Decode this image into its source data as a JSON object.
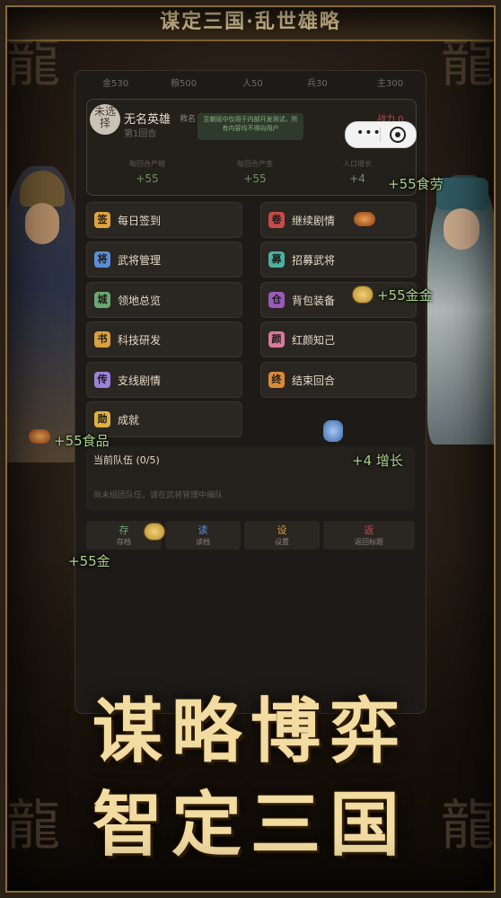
{
  "header": {
    "title": "谋定三国·乱世雄略"
  },
  "resources": [
    {
      "label": "金",
      "value": "530"
    },
    {
      "label": "粮",
      "value": "500"
    },
    {
      "label": "人",
      "value": "50"
    },
    {
      "label": "兵",
      "value": "30"
    },
    {
      "label": "主",
      "value": "300"
    }
  ],
  "profile": {
    "avatar_text": "未选择",
    "name": "无名英雄",
    "faction": "救名",
    "turn": "第1回合",
    "notice": "至朝屈中仅用于内部开发测试，所有内容均不得向用户",
    "power": "战力 0",
    "stats": [
      {
        "label": "每回合产粮",
        "value": "+55"
      },
      {
        "label": "每回合产金",
        "value": "+55"
      },
      {
        "label": "人口增长",
        "value": "+4"
      }
    ]
  },
  "menu": {
    "left": [
      {
        "icon": "签",
        "label": "每日签到",
        "color": "#e0a43c"
      },
      {
        "icon": "将",
        "label": "武将管理",
        "color": "#5a8ed8"
      },
      {
        "icon": "城",
        "label": "领地总览",
        "color": "#6aa872"
      },
      {
        "icon": "书",
        "label": "科技研发",
        "color": "#d8a040"
      },
      {
        "icon": "传",
        "label": "支线剧情",
        "color": "#9a82d8"
      },
      {
        "icon": "勋",
        "label": "成就",
        "color": "#e0b040"
      }
    ],
    "right": [
      {
        "icon": "卷",
        "label": "继续剧情",
        "color": "#c84a4a"
      },
      {
        "icon": "募",
        "label": "招募武将",
        "color": "#4ab0a0"
      },
      {
        "icon": "仓",
        "label": "背包装备",
        "color": "#9a5ab8"
      },
      {
        "icon": "颜",
        "label": "红颜知己",
        "color": "#d87a9a"
      },
      {
        "icon": "终",
        "label": "结束回合",
        "color": "#d88a3a"
      }
    ]
  },
  "team": {
    "title": "当前队伍 (0/5)",
    "empty": "尚未组团队伍，请在武将管理中编队"
  },
  "bottom": [
    {
      "glyph": "存",
      "label": "存档",
      "color": "#6aa872"
    },
    {
      "glyph": "读",
      "label": "读档",
      "color": "#5a8ed8"
    },
    {
      "glyph": "设",
      "label": "设置",
      "color": "#d8a040"
    },
    {
      "glyph": "返",
      "label": "返回标题",
      "color": "#c84a4a"
    }
  ],
  "floats": {
    "food_top": "+55食劳",
    "gold_right": "+55金金",
    "food_left": "+55食品",
    "growth": "+4 增长",
    "gold_left": "+55金"
  },
  "slogan": {
    "line1": "谋略博弈",
    "line2": "智定三国"
  }
}
